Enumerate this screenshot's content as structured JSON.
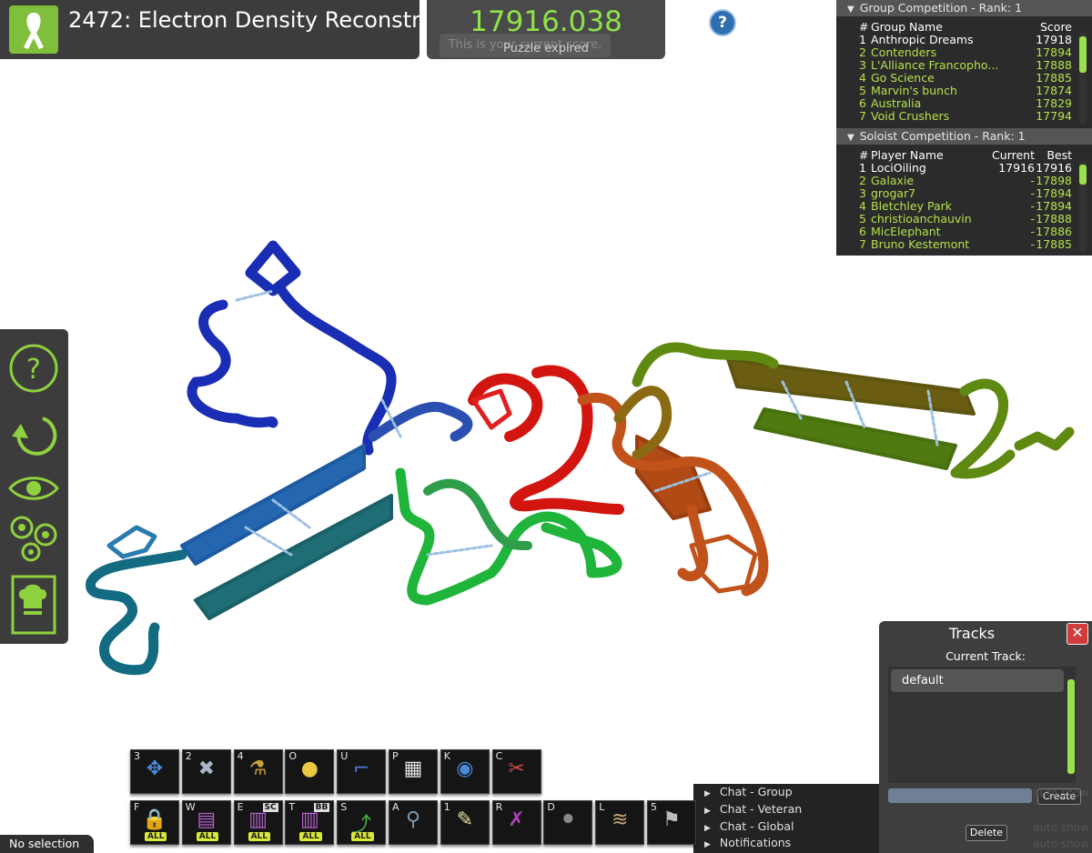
{
  "puzzle": {
    "title": "2472: Electron Density Reconstr..."
  },
  "score": {
    "value": "17916.038",
    "hint": "This is your current score.",
    "status": "Puzzle expired"
  },
  "help": {
    "label": "?"
  },
  "group_competition": {
    "header": "Group Competition - Rank: 1",
    "columns": {
      "rank": "#",
      "name": "Group Name",
      "score": "Score"
    },
    "rows": [
      {
        "rank": "1",
        "name": "Anthropic Dreams",
        "score": "17918"
      },
      {
        "rank": "2",
        "name": "Contenders",
        "score": "17894"
      },
      {
        "rank": "3",
        "name": "L'Alliance Francopho...",
        "score": "17888"
      },
      {
        "rank": "4",
        "name": "Go Science",
        "score": "17885"
      },
      {
        "rank": "5",
        "name": "Marvin's bunch",
        "score": "17874"
      },
      {
        "rank": "6",
        "name": "Australia",
        "score": "17829"
      },
      {
        "rank": "7",
        "name": "Void Crushers",
        "score": "17794"
      }
    ]
  },
  "soloist_competition": {
    "header": "Soloist Competition - Rank: 1",
    "columns": {
      "rank": "#",
      "name": "Player Name",
      "current": "Current",
      "best": "Best"
    },
    "rows": [
      {
        "rank": "1",
        "name": "LociOiling",
        "current": "17916",
        "best": "17916"
      },
      {
        "rank": "2",
        "name": "Galaxie",
        "current": "-",
        "best": "17898"
      },
      {
        "rank": "3",
        "name": "grogar7",
        "current": "-",
        "best": "17894"
      },
      {
        "rank": "4",
        "name": "Bletchley Park",
        "current": "-",
        "best": "17894"
      },
      {
        "rank": "5",
        "name": "christioanchauvin",
        "current": "-",
        "best": "17888"
      },
      {
        "rank": "6",
        "name": "MicElephant",
        "current": "-",
        "best": "17886"
      },
      {
        "rank": "7",
        "name": "Bruno Kestemont",
        "current": "-",
        "best": "17885"
      }
    ]
  },
  "left_toolbar": {
    "icons": [
      "help-icon",
      "undo-icon",
      "view-icon",
      "settings-gears-icon",
      "cookbook-icon"
    ]
  },
  "toolbar_top": [
    {
      "key": "3",
      "icon": "move-icon"
    },
    {
      "key": "2",
      "icon": "tools-icon"
    },
    {
      "key": "4",
      "icon": "shake-icon"
    },
    {
      "key": "O",
      "icon": "rebuild-icon"
    },
    {
      "key": "U",
      "icon": "tweak-icon"
    },
    {
      "key": "P",
      "icon": "contact-map-icon"
    },
    {
      "key": "K",
      "icon": "globe-icon"
    },
    {
      "key": "C",
      "icon": "cut-icon"
    }
  ],
  "toolbar_bottom": [
    {
      "key": "F",
      "icon": "freeze-all-icon",
      "badge": "ALL"
    },
    {
      "key": "W",
      "icon": "wiggle-all-icon",
      "badge": "ALL"
    },
    {
      "key": "E",
      "icon": "sidechain-all-icon",
      "badge": "ALL",
      "tag": "SC"
    },
    {
      "key": "T",
      "icon": "backbone-all-icon",
      "badge": "ALL",
      "tag": "BB"
    },
    {
      "key": "S",
      "icon": "shake-all-icon",
      "badge": "ALL"
    },
    {
      "key": "A",
      "icon": "mutate-icon"
    },
    {
      "key": "1",
      "icon": "notes-icon"
    },
    {
      "key": "R",
      "icon": "remove-band-icon"
    },
    {
      "key": "D",
      "icon": "disable-band-icon"
    },
    {
      "key": "L",
      "icon": "density-icon"
    },
    {
      "key": "5",
      "icon": "recipe-icon"
    }
  ],
  "selection_status": "No selection",
  "tracks": {
    "title": "Tracks",
    "current_label": "Current Track:",
    "items": [
      "default"
    ],
    "create_label": "Create",
    "delete_label": "Delete"
  },
  "chat": {
    "rows": [
      "Chat - Group",
      "Chat - Veteran",
      "Chat - Global",
      "Notifications"
    ],
    "auto_show_label": "auto show"
  },
  "colors": {
    "accent": "#8fd13f",
    "score": "#8fe24a",
    "leaderboard_text": "#b4e14c",
    "panel": "#3a3a3a"
  }
}
